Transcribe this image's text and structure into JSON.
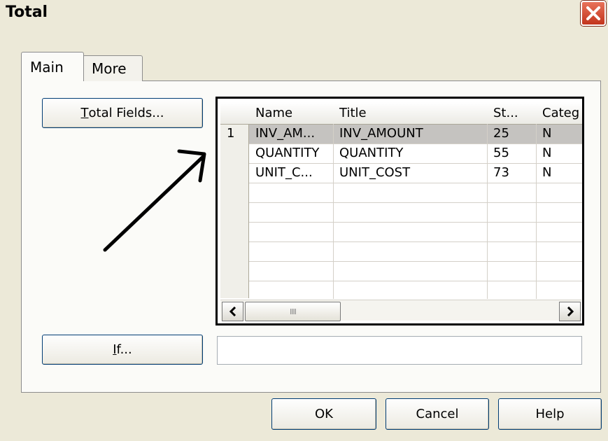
{
  "window": {
    "title": "Total"
  },
  "tabs": [
    {
      "label": "Main",
      "active": true
    },
    {
      "label": "More",
      "active": false
    }
  ],
  "buttons": {
    "total_fields_rest": "otal Fields...",
    "total_fields_mnemonic": "T",
    "if_mnemonic": "I",
    "if_rest": "f...",
    "ok": "OK",
    "cancel": "Cancel",
    "help": "Help"
  },
  "grid": {
    "columns": [
      "Name",
      "Title",
      "St...",
      "Categ"
    ],
    "rows": [
      {
        "num": "1",
        "name": "INV_AM...",
        "title": "INV_AMOUNT",
        "st": "25",
        "categ": "N",
        "selected": true
      },
      {
        "num": "",
        "name": "QUANTITY",
        "title": "QUANTITY",
        "st": "55",
        "categ": "N",
        "selected": false
      },
      {
        "num": "",
        "name": "UNIT_C...",
        "title": "UNIT_COST",
        "st": "73",
        "categ": "N",
        "selected": false
      }
    ],
    "scroll_thumb_grip": "IIII"
  },
  "if_input": {
    "value": ""
  },
  "colors": {
    "title_bg": "#ece9d8",
    "close": "#d9512c",
    "selection": "#c5c3c0"
  }
}
